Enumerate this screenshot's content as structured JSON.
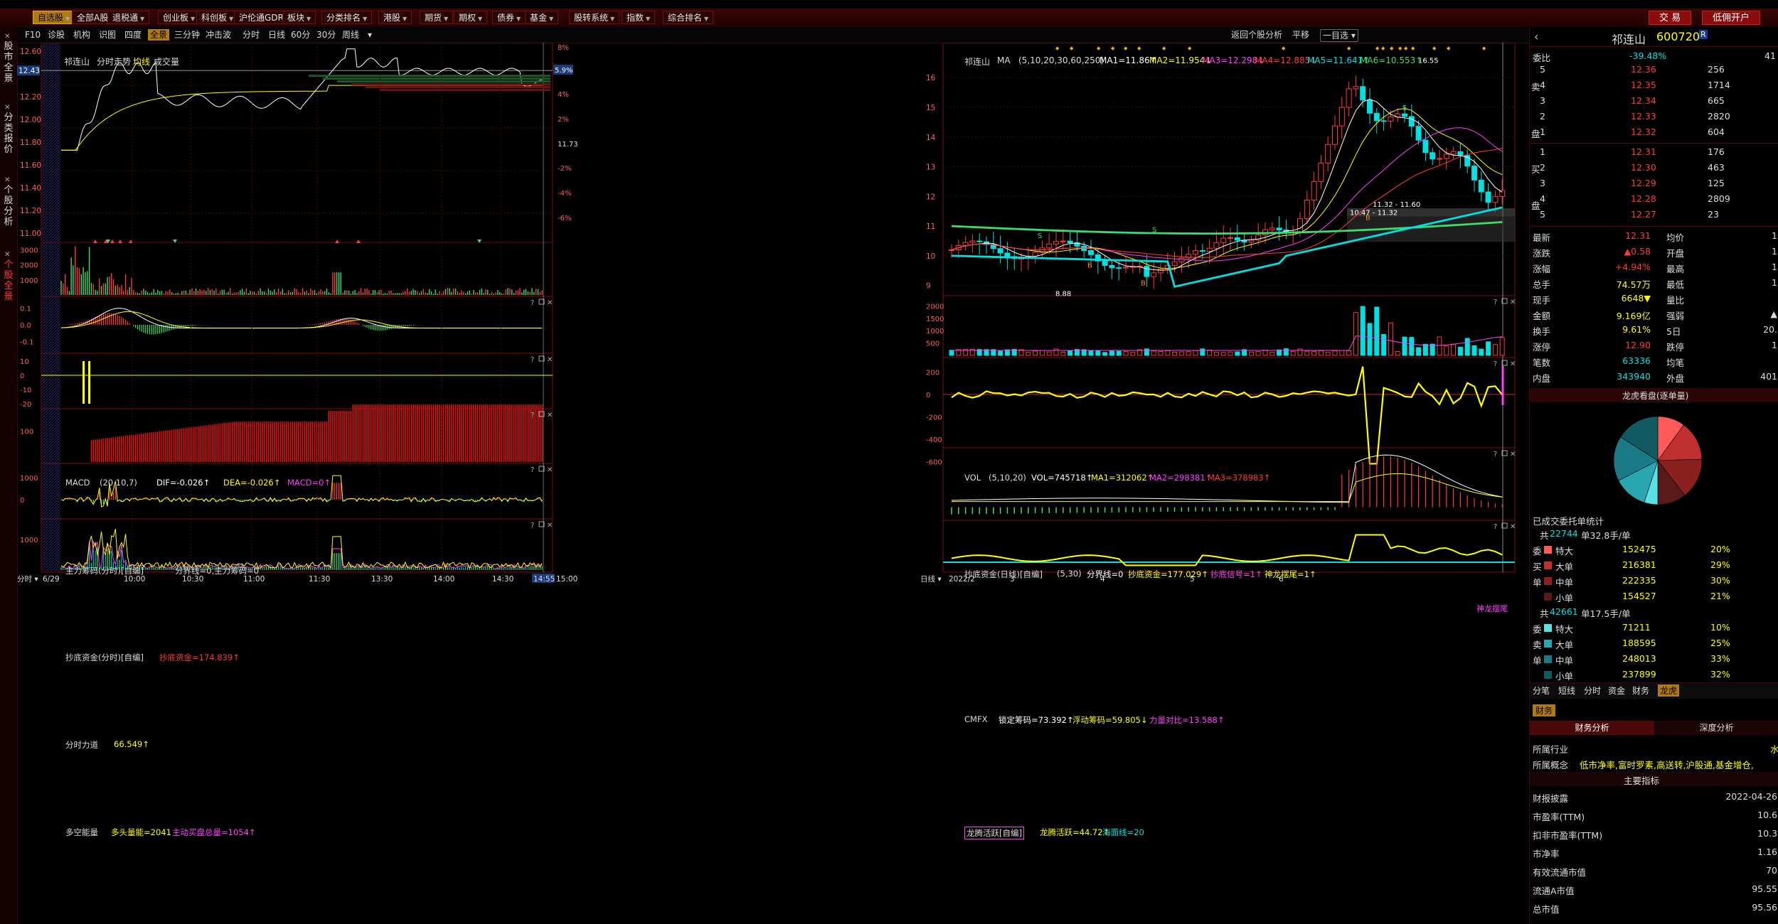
{
  "menubar": {
    "items": [
      "自选股",
      "全部A股",
      "退税通",
      "创业板",
      "科创板",
      "沪伦通GDR",
      "板块",
      "分类排名",
      "港股",
      "期货",
      "期权",
      "债券",
      "基金",
      "股转系统",
      "指数",
      "综合排名"
    ],
    "active": 0,
    "right_buttons": [
      "交 易",
      "低佣开户"
    ]
  },
  "sidebar": {
    "items": [
      "股市全景",
      "分类报价",
      "个股分析",
      "个股全景"
    ],
    "active": 3
  },
  "tabbar": {
    "left": [
      "F10",
      "诊股",
      "机构",
      "识图",
      "四度",
      "全景",
      "三分钟",
      "冲击波"
    ],
    "left_active": 5,
    "periods": [
      "分时",
      "日线",
      "60分",
      "30分",
      "周线"
    ],
    "right": [
      "返回个股分析",
      "平移",
      "一目选"
    ]
  },
  "left": {
    "title": "祁连山",
    "subtitles": [
      "分时走势",
      "均线",
      "成交量"
    ],
    "price_ticks": [
      "12.60",
      "12.43",
      "12.20",
      "12.00",
      "11.80",
      "11.60",
      "11.40",
      "11.20",
      "11.00"
    ],
    "current_price": "12.43",
    "pct_ticks": [
      "8%",
      "5.9%",
      "4%",
      "2%",
      "11.73",
      "-2%",
      "-4%",
      "-6%"
    ],
    "current_pct": "5.9%",
    "vol_ticks": [
      "3000",
      "2000",
      "1000"
    ],
    "macd": {
      "name": "MACD",
      "params": "(20,10,7)",
      "dif": "DIF=-0.026↑",
      "dea": "DEA=-0.026↑",
      "macd": "MACD=0↑",
      "ticks": [
        "0.1",
        "0.0",
        "-0.1"
      ]
    },
    "zlcm": {
      "name": "主力筹码(分时)[自编]",
      "text": "分界线=0,主力筹码=0",
      "ticks": [
        "10",
        "0",
        "-10",
        "-20"
      ]
    },
    "cdzj": {
      "name": "抄底资金(分时)[自编]",
      "text": "抄底资金=174.839↑",
      "ticks": [
        "100"
      ]
    },
    "fsld": {
      "name": "分时力道",
      "text": "66.549↑",
      "ticks": [
        "1000",
        "0"
      ]
    },
    "dknl": {
      "name": "多空能量",
      "text1": "多头量能=2041",
      "text2": "主动买盘总量=1054↑",
      "ticks": [
        "1000"
      ]
    },
    "xaxis": [
      "分时",
      "6/29",
      "10:00",
      "10:30",
      "11:00",
      "11:30",
      "13:30",
      "14:00",
      "14:30",
      "14:55",
      "15:00"
    ]
  },
  "mid": {
    "title": "祁连山",
    "ma_name": "MA",
    "ma_params": "(5,10,20,30,60,250)",
    "mas": [
      "MA1=11.86↑",
      "MA2=11.954↓",
      "MA3=12.298↓",
      "MA4=12.885↓",
      "MA5=11.641↑",
      "MA6=10.553↑"
    ],
    "price_ticks": [
      "16",
      "15",
      "14",
      "13",
      "12",
      "11",
      "10",
      "9"
    ],
    "high_label": "16.55",
    "low_label": "8.88",
    "box_label1": "11.32 - 11.60",
    "box_label2": "10.47 - 11.32",
    "vol": {
      "name": "VOL",
      "params": "(5,10,20)",
      "vals": [
        "VOL=745718↑",
        "MA1=312062↑",
        "MA2=298381↑",
        "MA3=378983↑"
      ],
      "ticks": [
        "2000",
        "1500",
        "1000",
        "500"
      ]
    },
    "cdzj": {
      "name": "抄底资金(日线)[自编]",
      "params": "(5,30)",
      "vals": [
        "分界线=0",
        "抄底资金=177.029↑",
        "抄底信号=1↑",
        "神龙摆尾=1↑"
      ],
      "ticks": [
        "200",
        "0",
        "-200",
        "-400",
        "-600"
      ],
      "flag": "神龙摆尾"
    },
    "cmfx": {
      "name": "CMFX",
      "vals": [
        "锁定筹码=73.392↑",
        "浮动筹码=59.805↓",
        "力量对比=13.588↑"
      ]
    },
    "lths": {
      "name": "龙腾活跃[自编]",
      "vals": [
        "龙腾活跃=44.72↑",
        "海面线=20"
      ]
    },
    "xaxis": [
      "日线",
      "2022/2",
      "3",
      "4",
      "5",
      "6"
    ]
  },
  "right": {
    "name": "祁连山",
    "code": "600720",
    "badge": "R",
    "weibi_label": "委比",
    "weibi": "-39.48%",
    "weibi_r": "41",
    "asks": [
      {
        "lvl": "5",
        "price": "12.36",
        "vol": "256"
      },
      {
        "lvl": "4",
        "price": "12.35",
        "vol": "1714"
      },
      {
        "lvl": "3",
        "price": "12.34",
        "vol": "665"
      },
      {
        "lvl": "2",
        "price": "12.33",
        "vol": "2820"
      },
      {
        "lvl": "1",
        "price": "12.32",
        "vol": "604"
      }
    ],
    "bids": [
      {
        "lvl": "1",
        "price": "12.31",
        "vol": "176"
      },
      {
        "lvl": "2",
        "price": "12.30",
        "vol": "463"
      },
      {
        "lvl": "3",
        "price": "12.29",
        "vol": "125"
      },
      {
        "lvl": "4",
        "price": "12.28",
        "vol": "2809"
      },
      {
        "lvl": "5",
        "price": "12.27",
        "vol": "23"
      }
    ],
    "ask_side": [
      "卖",
      "盘"
    ],
    "bid_side": [
      "买",
      "盘"
    ],
    "quote": [
      {
        "l": "最新",
        "v": "12.31",
        "l2": "均价",
        "v2": "1"
      },
      {
        "l": "涨跌",
        "v": "▲0.58",
        "l2": "开盘",
        "v2": "1"
      },
      {
        "l": "涨幅",
        "v": "+4.94%",
        "l2": "最高",
        "v2": "1"
      },
      {
        "l": "总手",
        "v": "74.57万",
        "l2": "最低",
        "v2": "1"
      },
      {
        "l": "现手",
        "v": "6648▼",
        "l2": "量比",
        "v2": ""
      },
      {
        "l": "金额",
        "v": "9.169亿",
        "l2": "强弱",
        "v2": "▲"
      },
      {
        "l": "换手",
        "v": "9.61%",
        "l2": "5日",
        "v2": "20."
      },
      {
        "l": "涨停",
        "v": "12.90",
        "l2": "跌停",
        "v2": "1"
      },
      {
        "l": "笔数",
        "v": "63336",
        "l2": "均笔",
        "v2": ""
      },
      {
        "l": "内盘",
        "v": "343940",
        "l2": "外盘",
        "v2": "401"
      }
    ],
    "pie_title": "龙虎看盘(逐单量)",
    "pie": [
      {
        "label": "特大",
        "pct": 20,
        "color": "#ff5a5a"
      },
      {
        "label": "大单",
        "pct": 29,
        "color": "#c03030"
      },
      {
        "label": "中单",
        "pct": 30,
        "color": "#8a2020"
      },
      {
        "label": "小单",
        "pct": 21,
        "color": "#5a1a1a"
      },
      {
        "label": "特大",
        "pct": 10,
        "color": "#5ae0e0"
      },
      {
        "label": "大单",
        "pct": 25,
        "color": "#2aa6b0"
      },
      {
        "label": "中单",
        "pct": 33,
        "color": "#1a7a86"
      },
      {
        "label": "小单",
        "pct": 32,
        "color": "#125a62"
      }
    ],
    "stats_title": "已成交委托单统计",
    "buy_summary": {
      "prefix": "共",
      "count": "22744",
      "suffix": "单32.8手/单"
    },
    "buy_rows": [
      {
        "side": "委",
        "label": "特大",
        "vol": "152475",
        "pct": "20%",
        "color": "#ff5a5a"
      },
      {
        "side": "买",
        "label": "大单",
        "vol": "216381",
        "pct": "29%",
        "color": "#c03030"
      },
      {
        "side": "单",
        "label": "中单",
        "vol": "222335",
        "pct": "30%",
        "color": "#8a2020"
      },
      {
        "side": "",
        "label": "小单",
        "vol": "154527",
        "pct": "21%",
        "color": "#5a1a1a"
      }
    ],
    "sell_summary": {
      "prefix": "共",
      "count": "42661",
      "suffix": "单17.5手/单"
    },
    "sell_rows": [
      {
        "side": "委",
        "label": "特大",
        "vol": "71211",
        "pct": "10%",
        "color": "#5ae0e0"
      },
      {
        "side": "卖",
        "label": "大单",
        "vol": "188595",
        "pct": "25%",
        "color": "#2aa6b0"
      },
      {
        "side": "单",
        "label": "中单",
        "vol": "248013",
        "pct": "33%",
        "color": "#1a7a86"
      },
      {
        "side": "",
        "label": "小单",
        "vol": "237899",
        "pct": "32%",
        "color": "#125a62"
      }
    ],
    "bottom_tabs": [
      "分笔",
      "短线",
      "分时",
      "资金",
      "财务",
      "龙虎"
    ],
    "bottom_active": 5,
    "fin_tab": "财务",
    "fin_tabs": [
      "财务分析",
      "深度分析"
    ],
    "industry_label": "所属行业",
    "industry_value": "水",
    "concept_label": "所属概念",
    "concept_value": "低市净率,富时罗素,高送转,沪股通,基金增仓,",
    "indicators_title": "主要指标",
    "indicators": [
      {
        "l": "财报披露",
        "v": "2022-04-26"
      },
      {
        "l": "市盈率(TTM)",
        "v": "10.6"
      },
      {
        "l": "扣非市盈率(TTM)",
        "v": "10.3"
      },
      {
        "l": "市净率",
        "v": "1.16"
      },
      {
        "l": "有效流通市值",
        "v": "70"
      },
      {
        "l": "流通A市值",
        "v": "95.55"
      },
      {
        "l": "总市值",
        "v": "95.56"
      }
    ]
  },
  "colors": {
    "up": "#ff3b3b",
    "down": "#00e0e0",
    "yellow": "#ffff00",
    "magenta": "#ff40ff",
    "green": "#3ddc6a",
    "white": "#ffffff"
  }
}
